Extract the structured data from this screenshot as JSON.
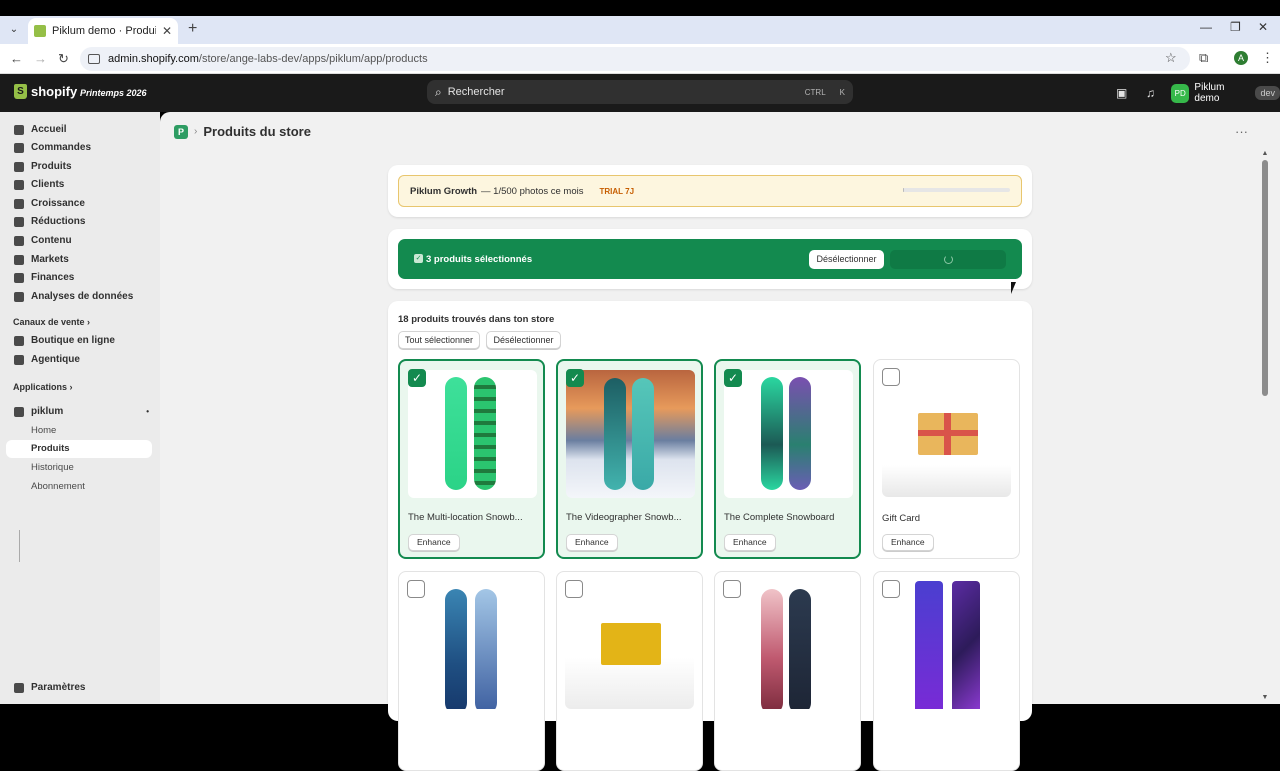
{
  "browser": {
    "tab_title": "Piklum demo · Produits du store",
    "url_host": "admin.shopify.com",
    "url_path": "/store/ange-labs-dev/apps/piklum/app/products",
    "profile_initial": "A"
  },
  "topbar": {
    "brand": "shopify",
    "edition": "Printemps 2026",
    "search_placeholder": "Rechercher",
    "kbd1": "CTRL",
    "kbd2": "K",
    "store_initials": "PD",
    "store_name": "Piklum demo",
    "store_badge": "dev"
  },
  "sidebar": {
    "items": [
      {
        "label": "Accueil"
      },
      {
        "label": "Commandes"
      },
      {
        "label": "Produits"
      },
      {
        "label": "Clients"
      },
      {
        "label": "Croissance"
      },
      {
        "label": "Réductions"
      },
      {
        "label": "Contenu"
      },
      {
        "label": "Markets"
      },
      {
        "label": "Finances"
      },
      {
        "label": "Analyses de données"
      }
    ],
    "channels_title": "Canaux de vente",
    "channels": [
      {
        "label": "Boutique en ligne"
      },
      {
        "label": "Agentique"
      }
    ],
    "apps_title": "Applications",
    "app_name": "piklum",
    "app_pages": [
      {
        "label": "Home"
      },
      {
        "label": "Produits"
      },
      {
        "label": "Historique"
      },
      {
        "label": "Abonnement"
      }
    ],
    "settings": "Paramètres"
  },
  "page": {
    "app_icon": "P",
    "title": "Produits du store"
  },
  "plan": {
    "name": "Piklum Growth",
    "usage": "— 1/500 photos ce mois",
    "trial": "TRIAL 7J",
    "usage_fraction": 0.002
  },
  "selection": {
    "text": "3 produits sélectionnés",
    "deselect": "Désélectionner"
  },
  "products": {
    "found": "18 produits trouvés dans ton store",
    "select_all": "Tout sélectionner",
    "deselect_all": "Désélectionner",
    "enhance_label": "Enhance",
    "items": [
      {
        "name": "The Multi-location Snowb...",
        "selected": true
      },
      {
        "name": "The Videographer Snowb...",
        "selected": true
      },
      {
        "name": "The Complete Snowboard",
        "selected": true
      },
      {
        "name": "Gift Card",
        "selected": false
      },
      {
        "name": "",
        "selected": false
      },
      {
        "name": "",
        "selected": false
      },
      {
        "name": "",
        "selected": false
      },
      {
        "name": "",
        "selected": false
      }
    ]
  },
  "colors": {
    "accent": "#138a4f",
    "brand": "#95bf47"
  }
}
